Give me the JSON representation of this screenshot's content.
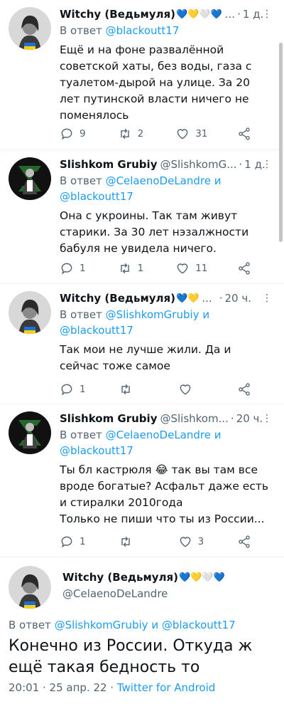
{
  "tweets": [
    {
      "author": "Witchy (Ведьмуля)",
      "hearts": "💙💛🤍💙",
      "handle": "",
      "ellipsis": "...",
      "time": "1 д.",
      "reply_prefix": "В ответ",
      "reply_mentions": "@blackoutt17",
      "reply_mentions_2": "",
      "text": "Ещё и на фоне развалённой советской хаты, без воды, газа с туалетом-дырой на улице. За 20 лет путинской власти ничего не поменялось",
      "replies": "9",
      "retweets": "2",
      "likes": "31",
      "avatar": "witchy"
    },
    {
      "author": "Slishkom Grubiy",
      "hearts": "",
      "handle": "@SlishkomG...",
      "ellipsis": "",
      "time": "1 д.",
      "reply_prefix": "В ответ",
      "reply_mentions": "@CelaenoDeLandre и",
      "reply_mentions_2": "@blackoutt17",
      "text": "Она с укроины. Так там живут старики. За 30 лет нэзалжности бабуля не увидела ничего.",
      "replies": "1",
      "retweets": "1",
      "likes": "11",
      "avatar": "grubiy"
    },
    {
      "author": "Witchy (Ведьмуля)",
      "hearts": "💙💛",
      "handle": "",
      "ellipsis": "...",
      "time": "20 ч.",
      "reply_prefix": "В ответ",
      "reply_mentions": "@SlishkomGrubiy и",
      "reply_mentions_2": "@blackoutt17",
      "text": "Так мои не лучше жили. Да и сейчас тоже самое",
      "replies": "1",
      "retweets": "",
      "likes": "",
      "avatar": "witchy"
    },
    {
      "author": "Slishkom Grubiy",
      "hearts": "",
      "handle": "@Slishkom...",
      "ellipsis": "",
      "time": "20 ч.",
      "reply_prefix": "В ответ",
      "reply_mentions": "@CelaenoDeLandre и",
      "reply_mentions_2": "@blackoutt17",
      "text": "Ты бл кастрюля 😂 так вы там все вроде богатые? Асфальт даже есть и стиралки 2010года\nТолько не пиши что ты из России...",
      "replies": "1",
      "retweets": "",
      "likes": "3",
      "avatar": "grubiy"
    }
  ],
  "main_tweet": {
    "author": "Witchy (Ведьмуля)",
    "hearts": "💙💛🤍💙",
    "handle": "@CelaenoDeLandre",
    "reply_prefix": "В ответ",
    "reply_mentions": "@SlishkomGrubiy и @blackoutt17",
    "text": "Конечно из России. Откуда ж ещё такая бедность то",
    "timestamp": "20:01 · 25 апр. 22 ·",
    "source": "Twitter for Android"
  },
  "colors": {
    "accent": "#1d9bf0",
    "muted": "#536471",
    "text": "#0f1419"
  }
}
